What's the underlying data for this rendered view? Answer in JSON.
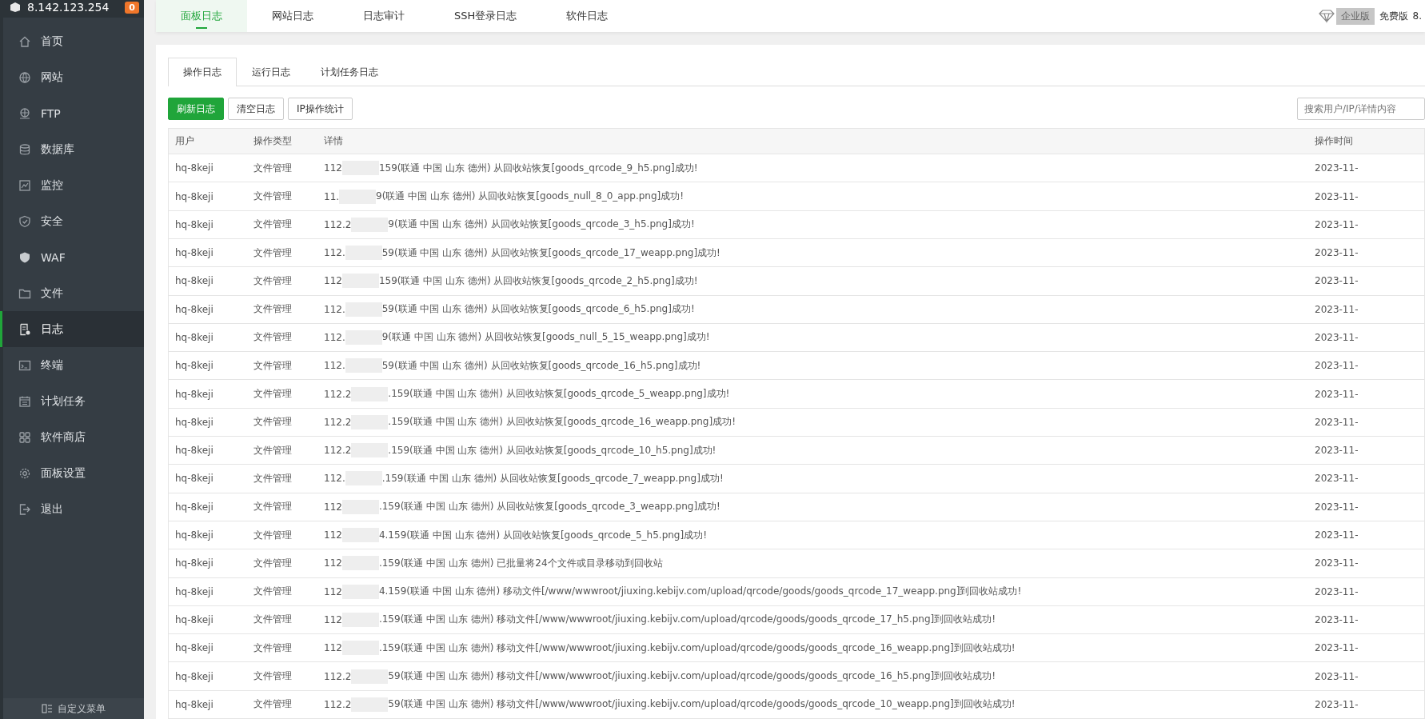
{
  "sidebar": {
    "server": "8.142.123.254",
    "badge": "0",
    "items": [
      {
        "label": "首页",
        "selected": false
      },
      {
        "label": "网站",
        "selected": false
      },
      {
        "label": "FTP",
        "selected": false
      },
      {
        "label": "数据库",
        "selected": false
      },
      {
        "label": "监控",
        "selected": false
      },
      {
        "label": "安全",
        "selected": false
      },
      {
        "label": "WAF",
        "selected": false
      },
      {
        "label": "文件",
        "selected": false
      },
      {
        "label": "日志",
        "selected": true
      },
      {
        "label": "终端",
        "selected": false
      },
      {
        "label": "计划任务",
        "selected": false
      },
      {
        "label": "软件商店",
        "selected": false
      },
      {
        "label": "面板设置",
        "selected": false
      },
      {
        "label": "退出",
        "selected": false
      }
    ],
    "footer": "自定义菜单"
  },
  "top_tabs": [
    {
      "label": "面板日志",
      "selected": true
    },
    {
      "label": "网站日志",
      "selected": false
    },
    {
      "label": "日志审计",
      "selected": false
    },
    {
      "label": "SSH登录日志",
      "selected": false
    },
    {
      "label": "软件日志",
      "selected": false
    }
  ],
  "edition": {
    "enterprise": "企业版",
    "free": "免费版",
    "version": "8."
  },
  "sub_tabs": [
    {
      "label": "操作日志",
      "selected": true
    },
    {
      "label": "运行日志",
      "selected": false
    },
    {
      "label": "计划任务日志",
      "selected": false
    }
  ],
  "buttons": [
    {
      "label": "刷新日志",
      "kind": "primary"
    },
    {
      "label": "清空日志",
      "kind": "default"
    },
    {
      "label": "IP操作统计",
      "kind": "default"
    }
  ],
  "search": {
    "placeholder": "搜索用户/IP/详情内容"
  },
  "table": {
    "columns": [
      "用户",
      "操作类型",
      "详情",
      "操作时间"
    ],
    "rows": [
      {
        "user": "hq-8keji",
        "type": "文件管理",
        "ip_start": "112",
        "detail": "159(联通 中国 山东 德州) 从回收站恢复[goods_qrcode_9_h5.png]成功!",
        "time": "2023-11-"
      },
      {
        "user": "hq-8keji",
        "type": "文件管理",
        "ip_start": "11.",
        "detail": "9(联通 中国 山东 德州) 从回收站恢复[goods_null_8_0_app.png]成功!",
        "time": "2023-11-"
      },
      {
        "user": "hq-8keji",
        "type": "文件管理",
        "ip_start": "112.2",
        "detail": "9(联通 中国 山东 德州) 从回收站恢复[goods_qrcode_3_h5.png]成功!",
        "time": "2023-11-"
      },
      {
        "user": "hq-8keji",
        "type": "文件管理",
        "ip_start": "112.",
        "detail": "59(联通 中国 山东 德州) 从回收站恢复[goods_qrcode_17_weapp.png]成功!",
        "time": "2023-11-"
      },
      {
        "user": "hq-8keji",
        "type": "文件管理",
        "ip_start": "112",
        "detail": "159(联通 中国 山东 德州) 从回收站恢复[goods_qrcode_2_h5.png]成功!",
        "time": "2023-11-"
      },
      {
        "user": "hq-8keji",
        "type": "文件管理",
        "ip_start": "112.",
        "detail": "59(联通 中国 山东 德州) 从回收站恢复[goods_qrcode_6_h5.png]成功!",
        "time": "2023-11-"
      },
      {
        "user": "hq-8keji",
        "type": "文件管理",
        "ip_start": "112.",
        "detail": "9(联通 中国 山东 德州) 从回收站恢复[goods_null_5_15_weapp.png]成功!",
        "time": "2023-11-"
      },
      {
        "user": "hq-8keji",
        "type": "文件管理",
        "ip_start": "112.",
        "detail": "59(联通 中国 山东 德州) 从回收站恢复[goods_qrcode_16_h5.png]成功!",
        "time": "2023-11-"
      },
      {
        "user": "hq-8keji",
        "type": "文件管理",
        "ip_start": "112.2",
        "detail": ".159(联通 中国 山东 德州) 从回收站恢复[goods_qrcode_5_weapp.png]成功!",
        "time": "2023-11-"
      },
      {
        "user": "hq-8keji",
        "type": "文件管理",
        "ip_start": "112.2",
        "detail": ".159(联通 中国 山东 德州) 从回收站恢复[goods_qrcode_16_weapp.png]成功!",
        "time": "2023-11-"
      },
      {
        "user": "hq-8keji",
        "type": "文件管理",
        "ip_start": "112.2",
        "detail": ".159(联通 中国 山东 德州) 从回收站恢复[goods_qrcode_10_h5.png]成功!",
        "time": "2023-11-"
      },
      {
        "user": "hq-8keji",
        "type": "文件管理",
        "ip_start": "112.",
        "detail": ".159(联通 中国 山东 德州) 从回收站恢复[goods_qrcode_7_weapp.png]成功!",
        "time": "2023-11-"
      },
      {
        "user": "hq-8keji",
        "type": "文件管理",
        "ip_start": "112",
        "detail": ".159(联通 中国 山东 德州) 从回收站恢复[goods_qrcode_3_weapp.png]成功!",
        "time": "2023-11-"
      },
      {
        "user": "hq-8keji",
        "type": "文件管理",
        "ip_start": "112",
        "detail": "4.159(联通 中国 山东 德州) 从回收站恢复[goods_qrcode_5_h5.png]成功!",
        "time": "2023-11-"
      },
      {
        "user": "hq-8keji",
        "type": "文件管理",
        "ip_start": "112",
        "detail": ".159(联通 中国 山东 德州) 已批量将24个文件或目录移动到回收站",
        "time": "2023-11-"
      },
      {
        "user": "hq-8keji",
        "type": "文件管理",
        "ip_start": "112",
        "detail": "4.159(联通 中国 山东 德州) 移动文件[/www/wwwroot/jiuxing.kebijv.com/upload/qrcode/goods/goods_qrcode_17_weapp.png]到回收站成功!",
        "time": "2023-11-"
      },
      {
        "user": "hq-8keji",
        "type": "文件管理",
        "ip_start": "112",
        "detail": ".159(联通 中国 山东 德州) 移动文件[/www/wwwroot/jiuxing.kebijv.com/upload/qrcode/goods/goods_qrcode_17_h5.png]到回收站成功!",
        "time": "2023-11-"
      },
      {
        "user": "hq-8keji",
        "type": "文件管理",
        "ip_start": "112",
        "detail": ".159(联通 中国 山东 德州) 移动文件[/www/wwwroot/jiuxing.kebijv.com/upload/qrcode/goods/goods_qrcode_16_weapp.png]到回收站成功!",
        "time": "2023-11-"
      },
      {
        "user": "hq-8keji",
        "type": "文件管理",
        "ip_start": "112.2",
        "detail": "59(联通 中国 山东 德州) 移动文件[/www/wwwroot/jiuxing.kebijv.com/upload/qrcode/goods/goods_qrcode_16_h5.png]到回收站成功!",
        "time": "2023-11-"
      },
      {
        "user": "hq-8keji",
        "type": "文件管理",
        "ip_start": "112.2",
        "detail": "59(联通 中国 山东 德州) 移动文件[/www/wwwroot/jiuxing.kebijv.com/upload/qrcode/goods/goods_qrcode_10_weapp.png]到回收站成功!",
        "time": "2023-11-"
      }
    ]
  }
}
